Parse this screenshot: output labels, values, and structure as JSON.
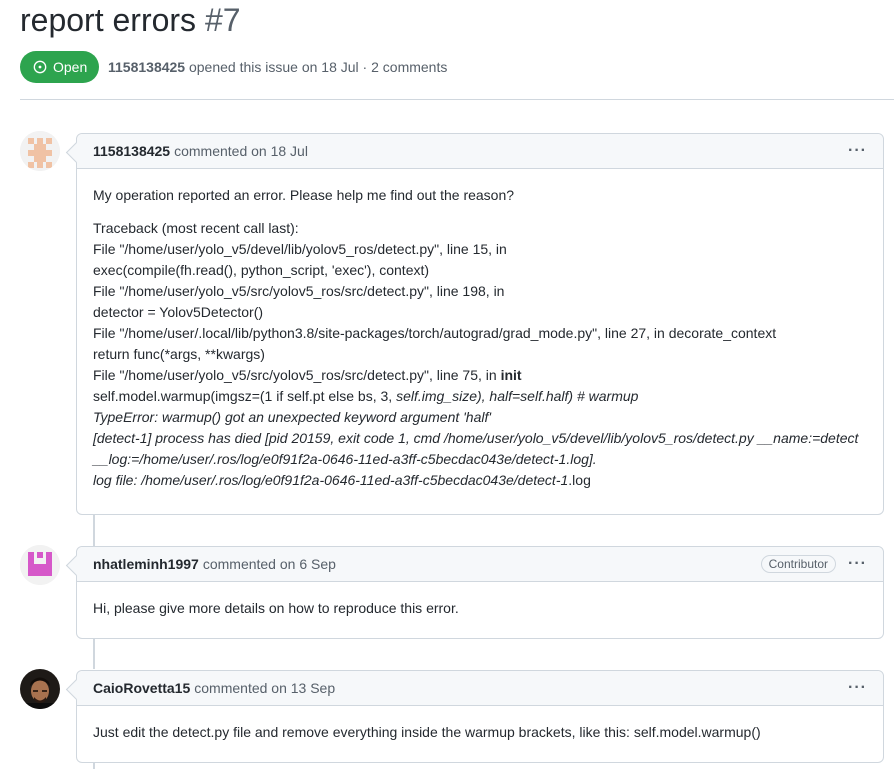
{
  "issue": {
    "title": "report errors",
    "number": "#7",
    "state": "Open",
    "meta_author": "1158138425",
    "meta_rest": "opened this issue on 18 Jul · 2 comments"
  },
  "comments": [
    {
      "author": "1158138425",
      "when": "commented on 18 Jul",
      "body": {
        "intro": "My operation reported an error. Please help me find out the reason?",
        "l1": "Traceback (most recent call last):",
        "l2": "File \"/home/user/yolo_v5/devel/lib/yolov5_ros/detect.py\", line 15, in",
        "l3": "exec(compile(fh.read(), python_script, 'exec'), context)",
        "l4": "File \"/home/user/yolo_v5/src/yolov5_ros/src/detect.py\", line 198, in",
        "l5": "detector = Yolov5Detector()",
        "l6": "File \"/home/user/.local/lib/python3.8/site-packages/torch/autograd/grad_mode.py\", line 27, in decorate_context",
        "l7": "return func(*args, **kwargs)",
        "l8a": "File \"/home/user/yolo_v5/src/yolov5_ros/src/detect.py\", line 75, in ",
        "l8b": "init",
        "l9a": "self.model.warmup(imgsz=(1 if self.pt else bs, 3, ",
        "l9b": "self.img_size), half=self.half) # warmup",
        "l10": "TypeError: warmup() got an unexpected keyword argument 'half'",
        "l11": "[detect-1] process has died [pid 20159, exit code 1, cmd /home/user/yolo_v5/devel/lib/yolov5_ros/detect.py __name:=detect",
        "l12": "__log:=/home/user/.ros/log/e0f91f2a-0646-11ed-a3ff-c5becdac043e/detect-1.log].",
        "l13a": "log file: /home/user/.ros/log/e0f91f2a-0646-11ed-a3ff-c5becdac043e/detect-1",
        "l13b": ".log"
      }
    },
    {
      "author": "nhatleminh1997",
      "when": "commented on 6 Sep",
      "badge": "Contributor",
      "body": "Hi, please give more details on how to reproduce this error."
    },
    {
      "author": "CaioRovetta15",
      "when": "commented on 13 Sep",
      "body": "Just edit the detect.py file and remove everything inside the warmup brackets, like this: self.model.warmup()"
    }
  ],
  "menu_glyph": "···",
  "colors": {
    "open_green": "#2da44e",
    "border": "#d0d7de",
    "header_bg": "#f6f8fa"
  }
}
